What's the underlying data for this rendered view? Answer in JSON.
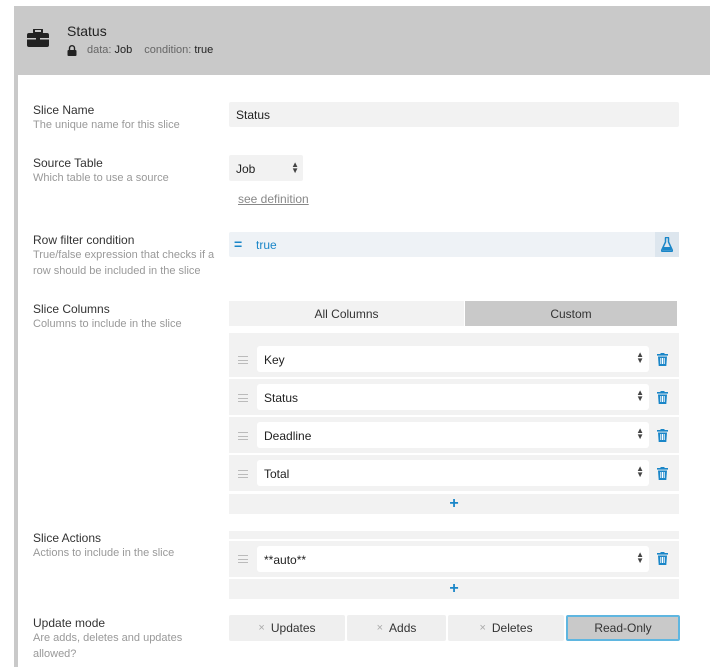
{
  "header": {
    "title": "Status",
    "data_key": "data:",
    "data_value": "Job",
    "condition_key": "condition:",
    "condition_value": "true"
  },
  "slice_name": {
    "label": "Slice Name",
    "description": "The unique name for this slice",
    "value": "Status"
  },
  "source_table": {
    "label": "Source Table",
    "description": "Which table to use a source",
    "value": "Job",
    "link": "see definition"
  },
  "row_filter": {
    "label": "Row filter condition",
    "description": "True/false expression that checks if a row should be included in the slice",
    "eq_symbol": "=",
    "value": "true"
  },
  "slice_columns": {
    "label": "Slice Columns",
    "description": "Columns to include in the slice",
    "tabs": [
      "All Columns",
      "Custom"
    ],
    "selected_tab": "Custom",
    "columns": [
      "Key",
      "Status",
      "Deadline",
      "Total"
    ],
    "add_label": "+"
  },
  "slice_actions": {
    "label": "Slice Actions",
    "description": "Actions to include in the slice",
    "actions": [
      "**auto**"
    ],
    "add_label": "+"
  },
  "update_mode": {
    "label": "Update mode",
    "description": "Are adds, deletes and updates allowed?",
    "options": [
      "Updates",
      "Adds",
      "Deletes",
      "Read-Only"
    ],
    "x_mark": "×",
    "selected": "Read-Only"
  },
  "colors": {
    "header_bg": "#c9c9c9",
    "accent_blue": "#1a86c8",
    "active_border": "#5fb6e0"
  }
}
